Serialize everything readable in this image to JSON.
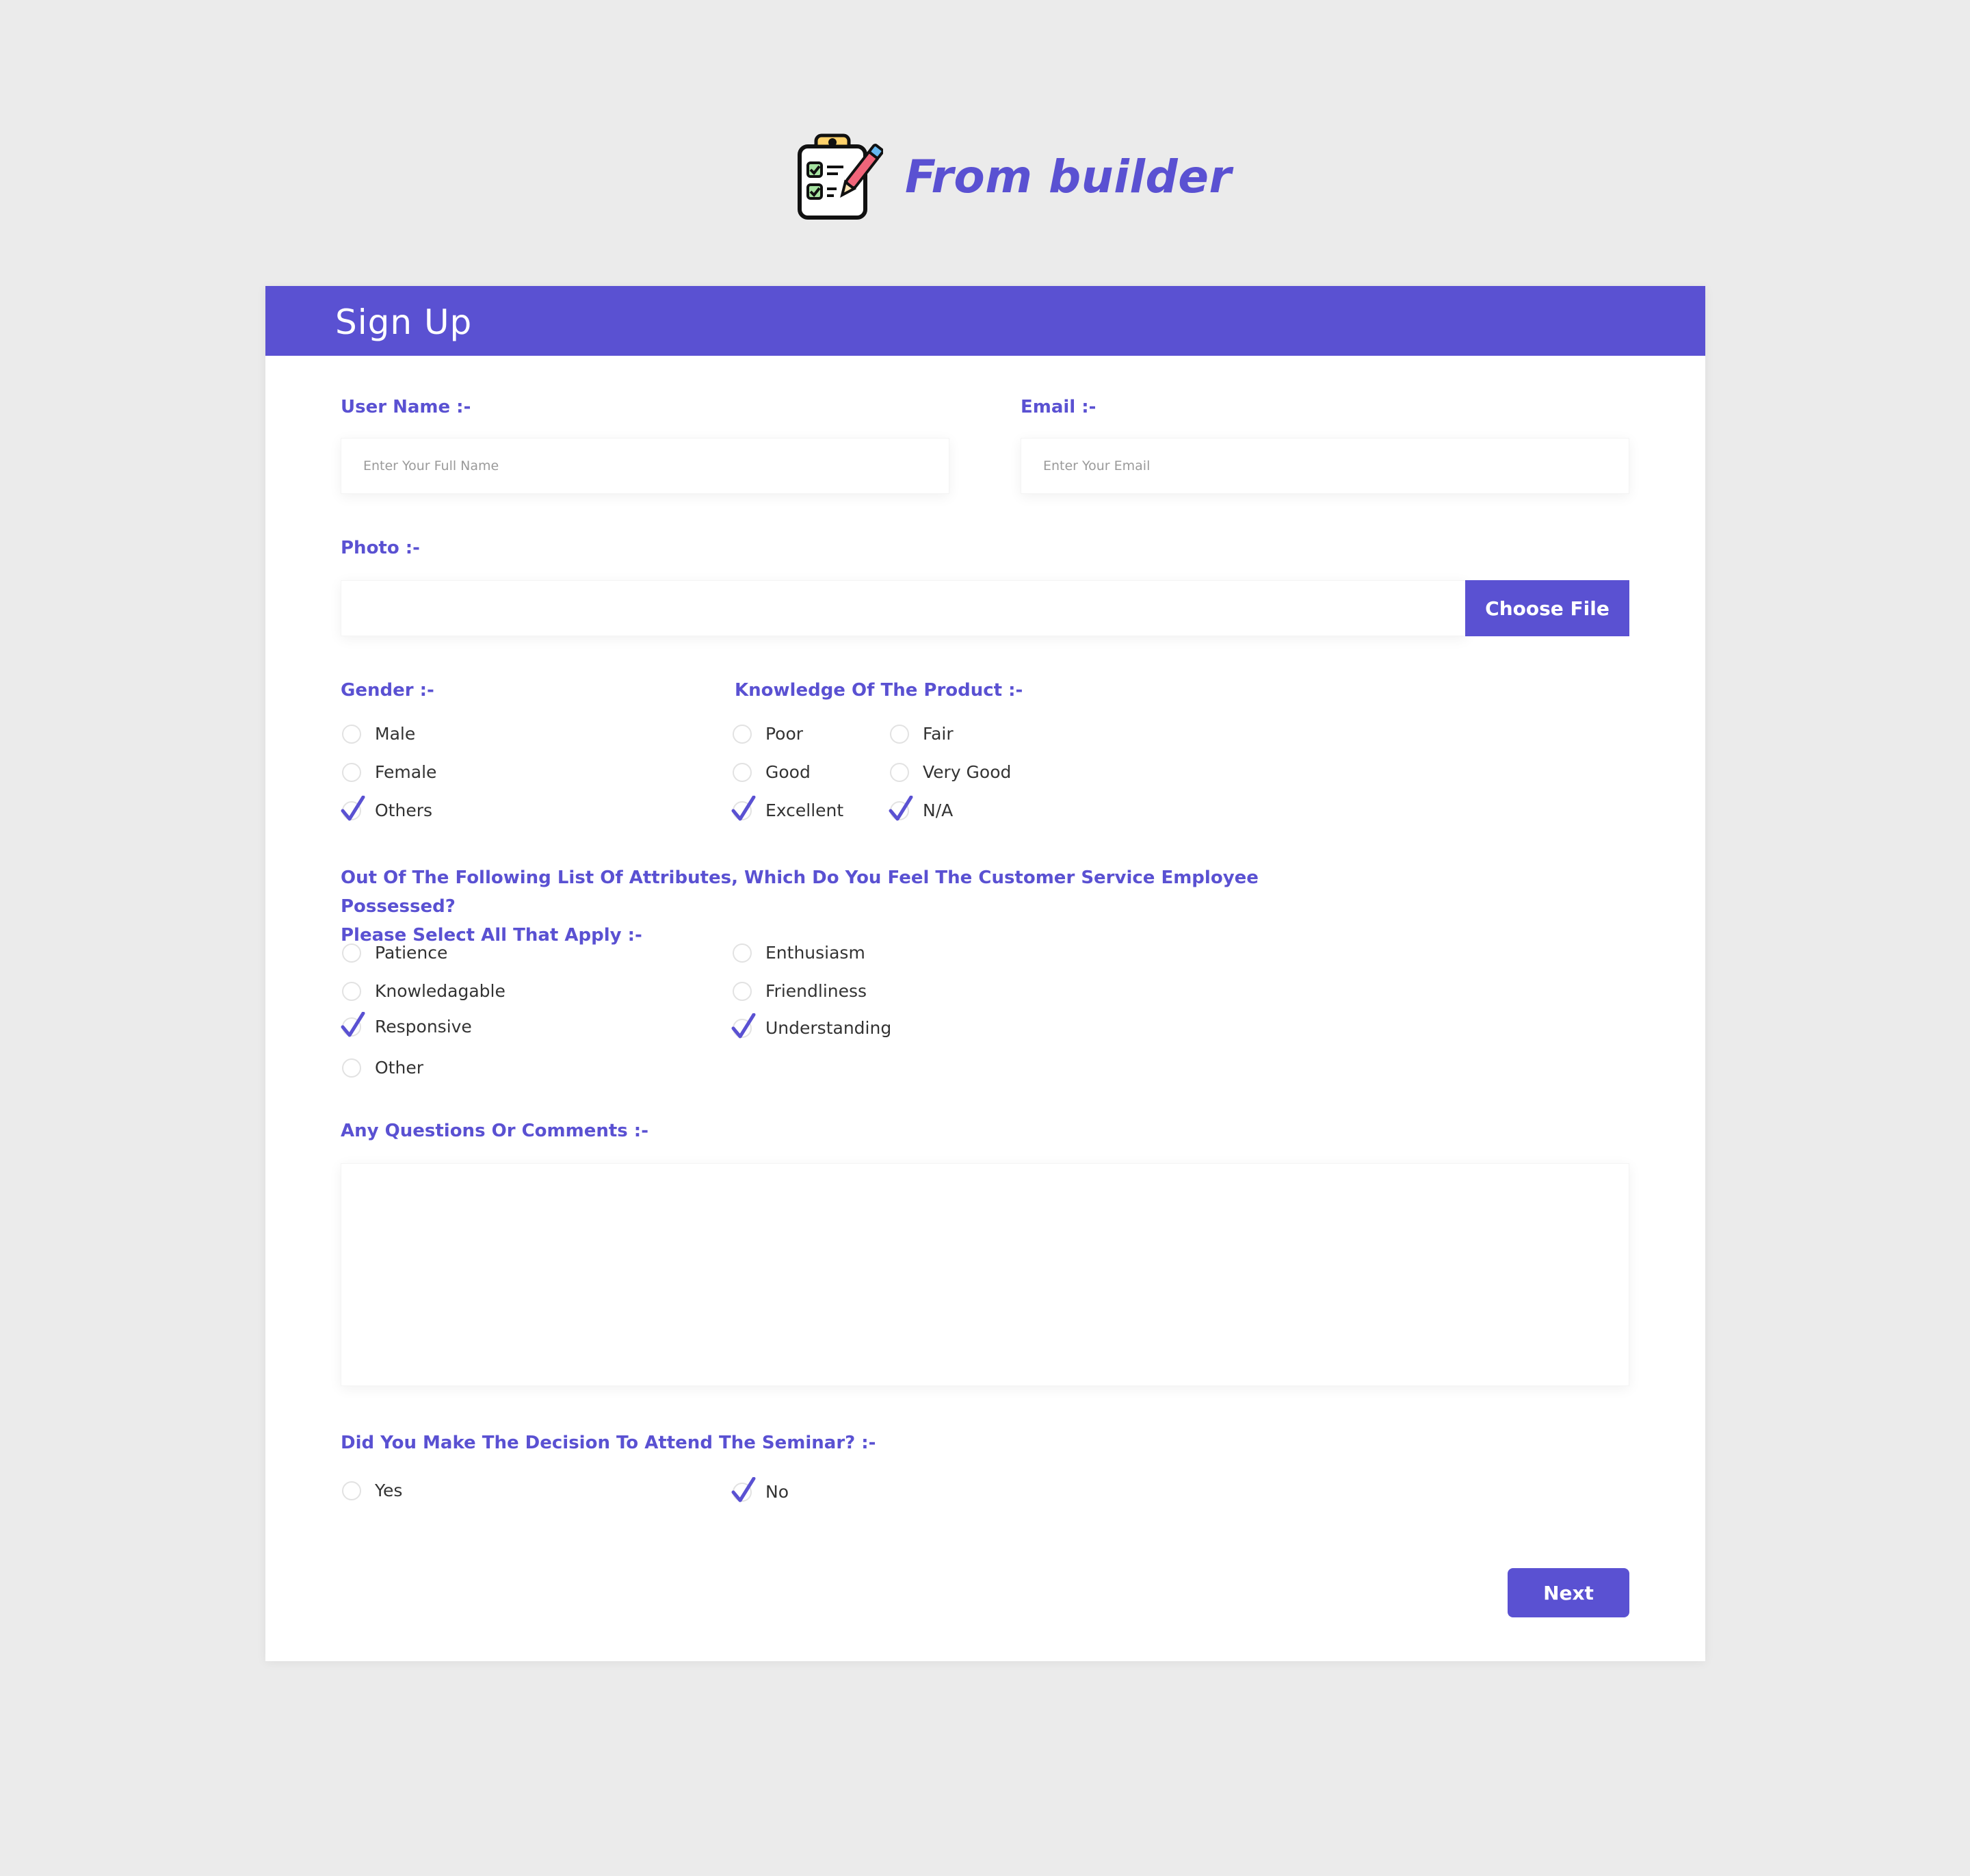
{
  "brand": {
    "title": "From builder"
  },
  "form": {
    "title": "Sign Up",
    "username": {
      "label": "User Name :-",
      "placeholder": "Enter Your Full Name",
      "value": ""
    },
    "email": {
      "label": "Email :-",
      "placeholder": "Enter Your Email",
      "value": ""
    },
    "photo": {
      "label": "Photo :-",
      "button": "Choose File"
    },
    "gender": {
      "label": "Gender :-",
      "options": [
        {
          "label": "Male",
          "checked": false
        },
        {
          "label": "Female",
          "checked": false
        },
        {
          "label": "Others",
          "checked": true
        }
      ]
    },
    "knowledge": {
      "label": "Knowledge Of The Product :-",
      "options": [
        {
          "label": "Poor",
          "checked": false
        },
        {
          "label": "Fair",
          "checked": false
        },
        {
          "label": "Good",
          "checked": false
        },
        {
          "label": "Very Good",
          "checked": false
        },
        {
          "label": "Excellent",
          "checked": true
        },
        {
          "label": "N/A",
          "checked": true
        }
      ]
    },
    "attributes": {
      "label_line1": "Out Of The Following List Of Attributes, Which Do You Feel  The Customer Service Employee Possessed?",
      "label_line2": "Please Select All That Apply :-",
      "options": [
        {
          "label": "Patience",
          "checked": false
        },
        {
          "label": "Enthusiasm",
          "checked": false
        },
        {
          "label": "Knowledagable",
          "checked": false
        },
        {
          "label": "Friendliness",
          "checked": false
        },
        {
          "label": "Responsive",
          "checked": true
        },
        {
          "label": "Understanding",
          "checked": true
        },
        {
          "label": "Other",
          "checked": false
        }
      ]
    },
    "comments": {
      "label": "Any Questions Or Comments :-",
      "value": ""
    },
    "seminar": {
      "label": "Did You Make The Decision To Attend The Seminar? :-",
      "options": [
        {
          "label": "Yes",
          "checked": false
        },
        {
          "label": "No",
          "checked": true
        }
      ]
    },
    "next_button": "Next"
  },
  "colors": {
    "accent": "#5a51d2",
    "background": "#ebebeb",
    "card": "#ffffff"
  },
  "icons": {
    "logo": "clipboard-checklist-pencil-icon",
    "checked": "check-icon",
    "unchecked": "empty-circle-icon"
  }
}
